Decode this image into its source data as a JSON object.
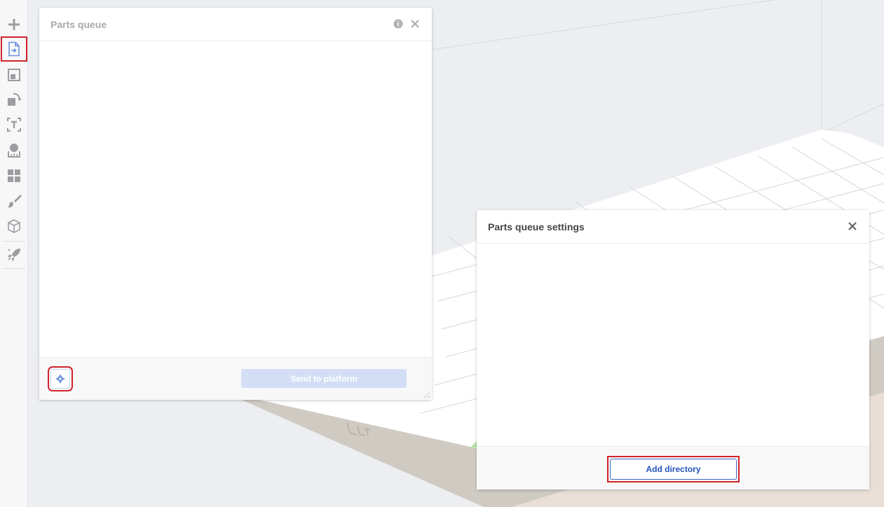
{
  "toolbar": {
    "tools": [
      {
        "icon": "plus-icon",
        "name": "add-tool"
      },
      {
        "icon": "import-file-icon",
        "name": "parts-queue-tool",
        "active": true
      },
      {
        "icon": "layout-icon",
        "name": "layout-tool"
      },
      {
        "icon": "transform-icon",
        "name": "transform-tool"
      },
      {
        "icon": "text-icon",
        "name": "text-tool"
      },
      {
        "icon": "measure-icon",
        "name": "measure-tool"
      },
      {
        "icon": "grid-icon",
        "name": "arrange-tool"
      },
      {
        "icon": "brush-icon",
        "name": "brush-tool"
      },
      {
        "icon": "cube-icon",
        "name": "view-tool"
      },
      {
        "icon": "rocket-icon",
        "name": "launch-tool"
      }
    ]
  },
  "parts_queue": {
    "title": "Parts queue",
    "send_label": "Send to platform"
  },
  "settings": {
    "title": "Parts queue settings",
    "add_directory_label": "Add directory"
  },
  "colors": {
    "accent": "#2552c0",
    "highlight": "#d2232a",
    "disabled_button": "#d3def6"
  }
}
